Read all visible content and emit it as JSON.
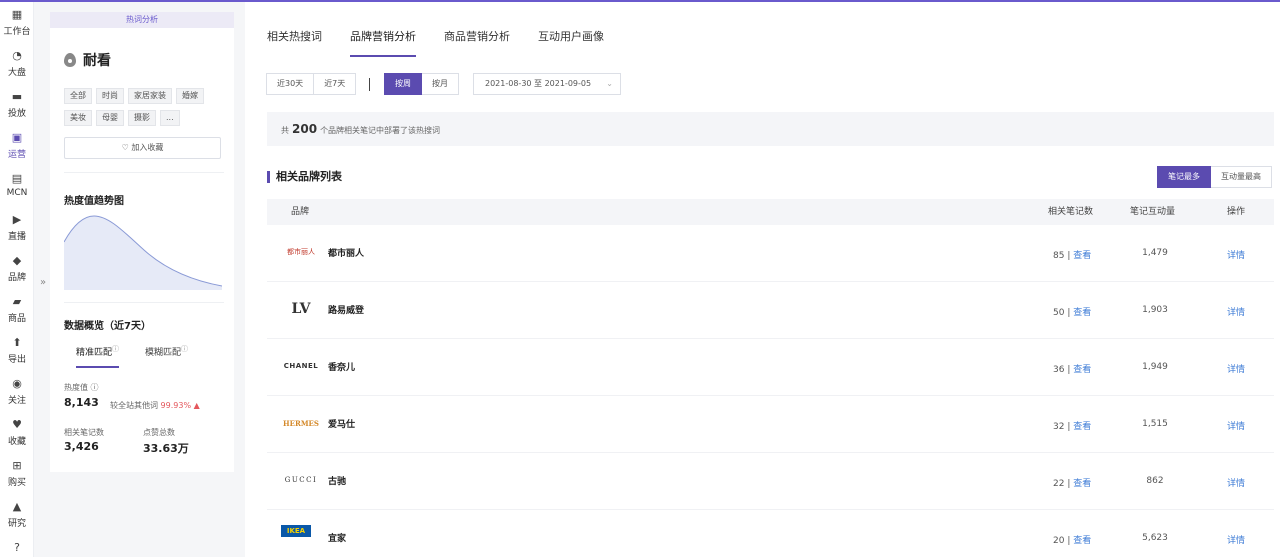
{
  "rail": [
    {
      "icon": "workbench-icon",
      "label": "工作台",
      "glyph": "▦"
    },
    {
      "icon": "pie-chart-icon",
      "label": "大盘",
      "glyph": "◔"
    },
    {
      "icon": "folder-icon",
      "label": "投放",
      "glyph": "▬"
    },
    {
      "icon": "chat-chart-icon",
      "label": "运营",
      "glyph": "▣",
      "active": true
    },
    {
      "icon": "mcn-icon",
      "label": "MCN",
      "glyph": "▤"
    },
    {
      "icon": "video-icon",
      "label": "直播",
      "glyph": "▶"
    },
    {
      "icon": "brand-icon",
      "label": "品牌",
      "glyph": "◆"
    },
    {
      "icon": "bag-icon",
      "label": "商品",
      "glyph": "▰"
    },
    {
      "icon": "export-icon",
      "label": "导出",
      "glyph": "⬆"
    },
    {
      "icon": "eye-icon",
      "label": "关注",
      "glyph": "◉"
    },
    {
      "icon": "heart-icon",
      "label": "收藏",
      "glyph": "♥"
    },
    {
      "icon": "cart-icon",
      "label": "购买",
      "glyph": "⊞"
    },
    {
      "icon": "flask-icon",
      "label": "研究",
      "glyph": "▲"
    },
    {
      "icon": "help-icon",
      "label": "",
      "glyph": "?"
    }
  ],
  "panel": {
    "badge": "热词分析",
    "keyword": "耐看",
    "tags": [
      "全部",
      "时尚",
      "家居家装",
      "婚嫁",
      "美妆",
      "母婴",
      "摄影",
      "..."
    ],
    "fav_label": "♡ 加入收藏",
    "trend_title": "热度值趋势图",
    "overview_title": "数据概览（近7天）",
    "match_tabs": [
      "精准匹配",
      "模糊匹配"
    ],
    "heat_label": "热度值 ⓘ",
    "heat_value": "8,143",
    "heat_note": "较全站其他词",
    "heat_pct": "99.93% ▲",
    "notes_label": "相关笔记数",
    "notes_value": "3,426",
    "likes_label": "点赞总数",
    "likes_value": "33.63万"
  },
  "main": {
    "tabs": [
      "相关热搜词",
      "品牌营销分析",
      "商品营销分析",
      "互动用户画像"
    ],
    "range_buttons": [
      "近30天",
      "近7天"
    ],
    "period_buttons": [
      "按周",
      "按月"
    ],
    "date_range": "2021-08-30 至 2021-09-05",
    "summary_prefix": "共",
    "summary_count": "200",
    "summary_suffix": "个品牌相关笔记中部署了该热搜词",
    "list_title": "相关品牌列表",
    "sort_buttons": [
      "笔记最多",
      "互动量最高"
    ],
    "columns": [
      "品牌",
      "相关笔记数",
      "笔记互动量",
      "操作"
    ],
    "view_label": "查看",
    "detail_label": "详情"
  },
  "rows": [
    {
      "logo": "都市丽人",
      "brand": "都市丽人",
      "notes": "85 |",
      "interactions": "1,479"
    },
    {
      "logo": "LV",
      "brand": "路易威登",
      "notes": "50 |",
      "interactions": "1,903"
    },
    {
      "logo": "CHANEL",
      "brand": "香奈儿",
      "notes": "36 |",
      "interactions": "1,949"
    },
    {
      "logo": "HERMES",
      "brand": "爱马仕",
      "notes": "32 |",
      "interactions": "1,515"
    },
    {
      "logo": "GUCCI",
      "brand": "古驰",
      "notes": "22 |",
      "interactions": "862"
    },
    {
      "logo": "IKEA",
      "brand": "宜家",
      "notes": "20 |",
      "interactions": "5,623"
    }
  ],
  "colors": {
    "accent": "#5b4bb0",
    "link": "#3d7bd6",
    "up": "#e4575c"
  }
}
